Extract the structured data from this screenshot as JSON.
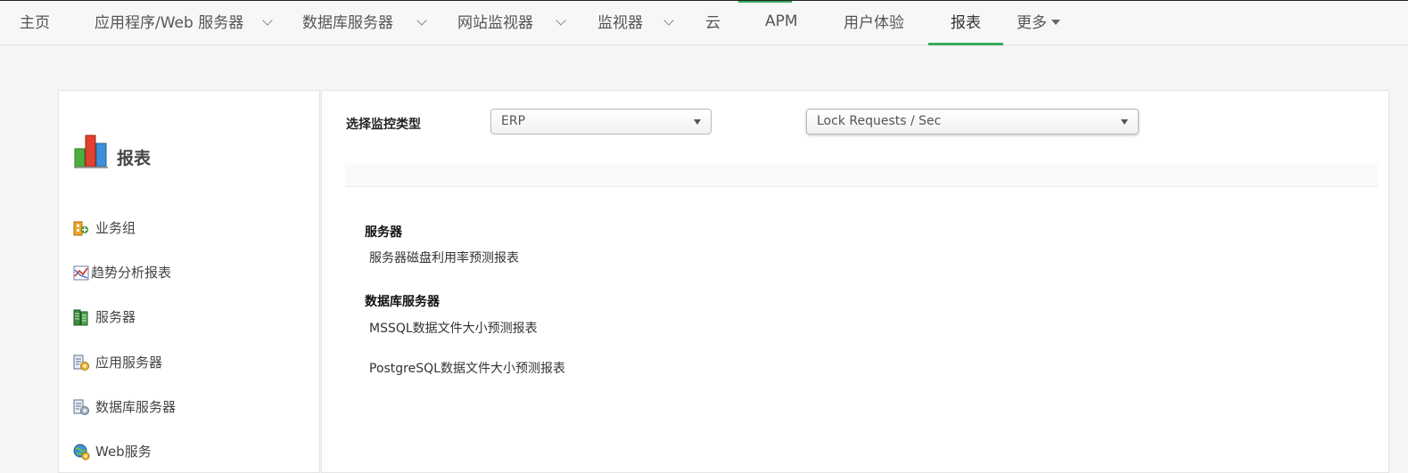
{
  "nav": {
    "items": [
      {
        "label": "主页"
      },
      {
        "label": "应用程序/Web 服务器"
      },
      {
        "label": "数据库服务器"
      },
      {
        "label": "网站监视器"
      },
      {
        "label": "监视器"
      },
      {
        "label": "云"
      },
      {
        "label": "APM"
      },
      {
        "label": "用户体验"
      },
      {
        "label": "报表"
      },
      {
        "label": "更多"
      }
    ],
    "active": "报表",
    "accent_color": "#3aaa5c"
  },
  "sidebar": {
    "title": "报表",
    "title_icon": "bar-chart-icon",
    "items": [
      {
        "label": "业务组",
        "icon": "business-group-icon"
      },
      {
        "label": "趋势分析报表",
        "icon": "trend-chart-icon"
      },
      {
        "label": "服务器",
        "icon": "server-icon"
      },
      {
        "label": "应用服务器",
        "icon": "app-server-icon"
      },
      {
        "label": "数据库服务器",
        "icon": "database-server-icon"
      },
      {
        "label": "Web服务",
        "icon": "web-service-icon"
      }
    ]
  },
  "main": {
    "monitor_type_label": "选择监控类型",
    "monitor_type_value": "ERP",
    "metric_value": "Lock Requests / Sec",
    "sections": [
      {
        "title": "服务器",
        "reports": [
          "服务器磁盘利用率预测报表"
        ]
      },
      {
        "title": "数据库服务器",
        "reports": [
          "MSSQL数据文件大小预测报表",
          "PostgreSQL数据文件大小预测报表"
        ]
      }
    ]
  }
}
